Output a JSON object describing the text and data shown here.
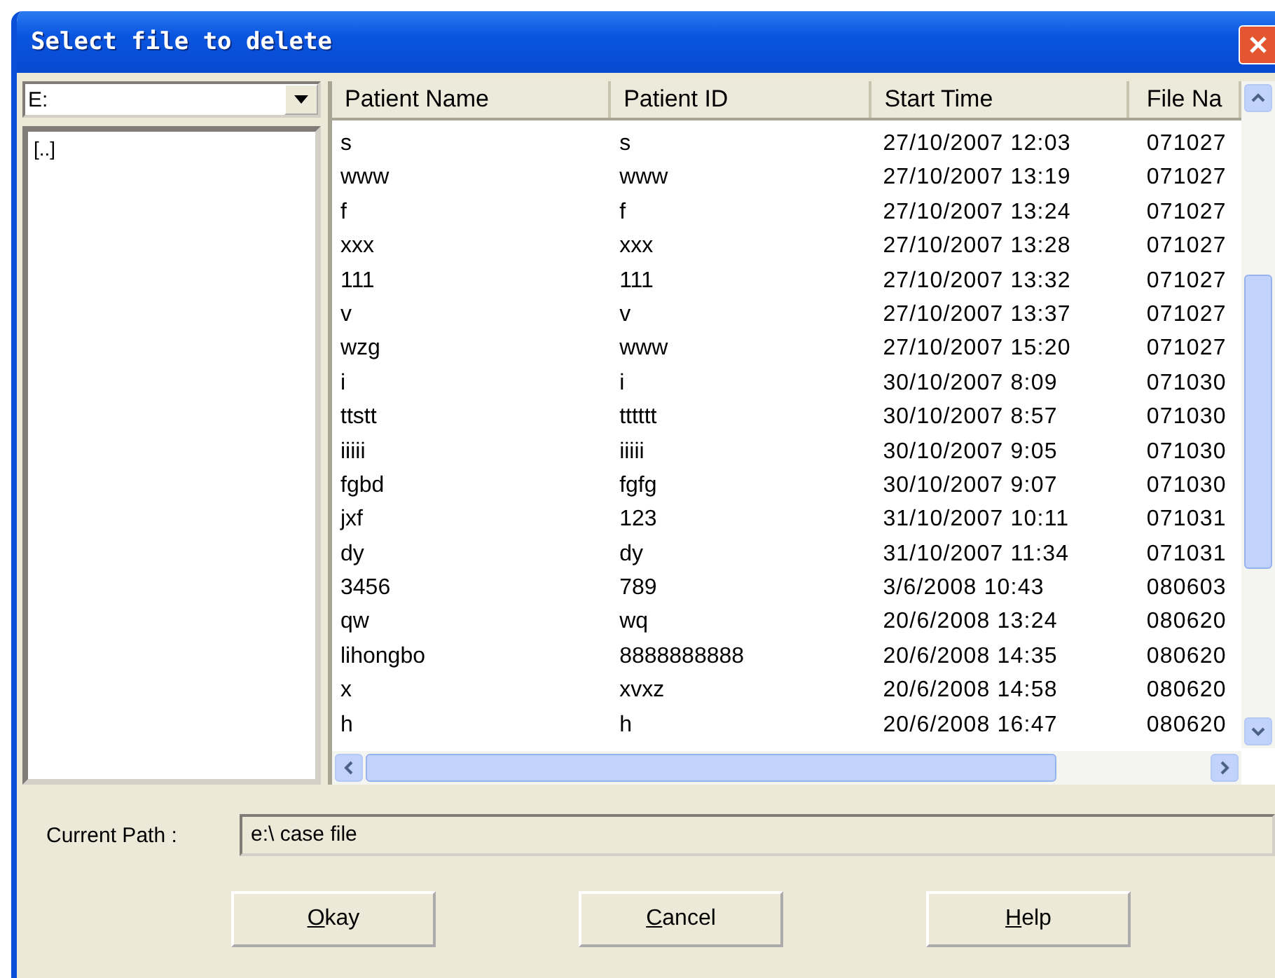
{
  "window": {
    "title": "Select file to delete"
  },
  "drive_select": {
    "value": "E:"
  },
  "folders": [
    {
      "label": "[..]",
      "selected": false
    }
  ],
  "table": {
    "columns": [
      "Patient Name",
      "Patient ID",
      "Start Time",
      "File Na"
    ],
    "rows": [
      [
        "s",
        "s",
        "27/10/2007 12:03",
        "071027"
      ],
      [
        "www",
        "www",
        "27/10/2007 13:19",
        "071027"
      ],
      [
        "f",
        "f",
        "27/10/2007 13:24",
        "071027"
      ],
      [
        "xxx",
        "xxx",
        "27/10/2007 13:28",
        "071027"
      ],
      [
        "111",
        "111",
        "27/10/2007 13:32",
        "071027"
      ],
      [
        "v",
        "v",
        "27/10/2007 13:37",
        "071027"
      ],
      [
        "wzg",
        "www",
        "27/10/2007 15:20",
        "071027"
      ],
      [
        "i",
        "i",
        "30/10/2007 8:09",
        "071030"
      ],
      [
        "ttstt",
        "tttttt",
        "30/10/2007 8:57",
        "071030"
      ],
      [
        "iiiii",
        "iiiii",
        "30/10/2007 9:05",
        "071030"
      ],
      [
        "fgbd",
        "fgfg",
        "30/10/2007 9:07",
        "071030"
      ],
      [
        "jxf",
        "123",
        "31/10/2007 10:11",
        "071031"
      ],
      [
        "dy",
        "dy",
        "31/10/2007 11:34",
        "071031"
      ],
      [
        "3456",
        "789",
        "3/6/2008 10:43",
        "080603"
      ],
      [
        "qw",
        "wq",
        "20/6/2008 13:24",
        "080620"
      ],
      [
        "lihongbo",
        "8888888888",
        "20/6/2008 14:35",
        "080620"
      ],
      [
        "x",
        "xvxz",
        "20/6/2008 14:58",
        "080620"
      ],
      [
        "h",
        "h",
        "20/6/2008 16:47",
        "080620"
      ]
    ]
  },
  "current_path": {
    "label": "Current Path :",
    "value": "e:\\ case file"
  },
  "buttons": [
    {
      "mnemonic": "O",
      "rest": "kay"
    },
    {
      "mnemonic": "C",
      "rest": "ancel"
    },
    {
      "mnemonic": "H",
      "rest": "elp"
    }
  ]
}
